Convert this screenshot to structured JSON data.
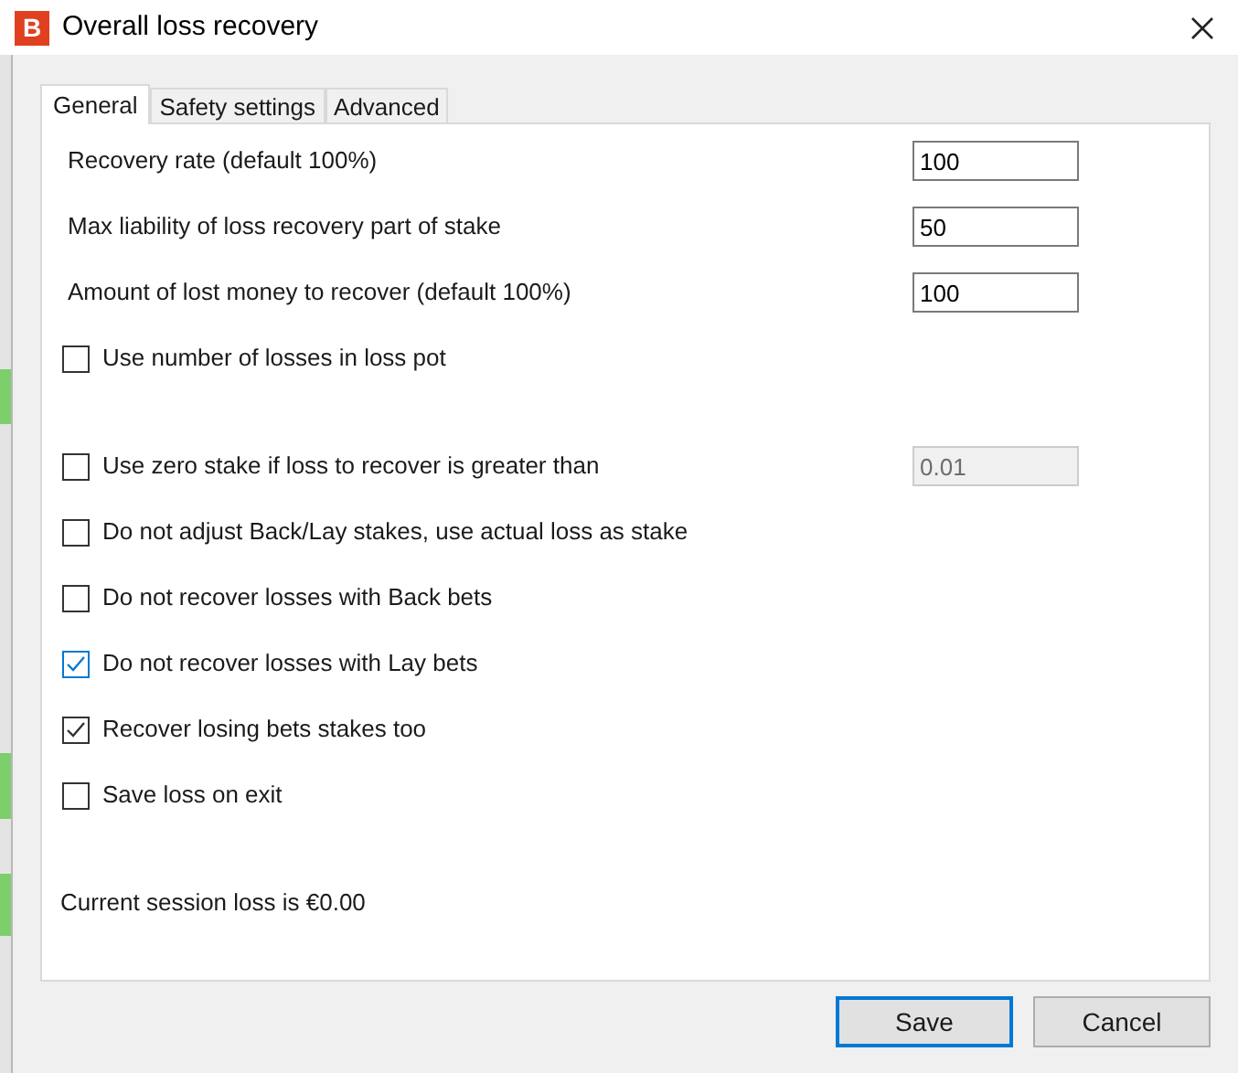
{
  "window": {
    "title": "Overall loss recovery",
    "logo_text": "B"
  },
  "tabs": [
    {
      "label": "General",
      "selected": true
    },
    {
      "label": "Safety settings",
      "selected": false
    },
    {
      "label": "Advanced",
      "selected": false
    }
  ],
  "options": [
    {
      "kind": "field",
      "label": "Recovery rate (default 100%)",
      "value": "100",
      "disabled": false
    },
    {
      "kind": "field",
      "label": "Max liability of loss recovery part of stake",
      "value": "50",
      "disabled": false
    },
    {
      "kind": "field",
      "label": "Amount of lost money to recover (default 100%)",
      "value": "100",
      "disabled": false
    },
    {
      "kind": "checkbox",
      "label": "Use number of losses in loss pot",
      "checked": false,
      "color": "#333333"
    },
    {
      "kind": "checkbox_with_field",
      "label": "Use zero stake if loss to recover is greater than",
      "checked": false,
      "color": "#333333",
      "value": "0.01",
      "disabled": true
    },
    {
      "kind": "checkbox",
      "label": "Do not adjust Back/Lay stakes, use actual loss as stake",
      "checked": false,
      "color": "#333333"
    },
    {
      "kind": "checkbox",
      "label": "Do not recover losses with Back bets",
      "checked": false,
      "color": "#333333"
    },
    {
      "kind": "checkbox",
      "label": "Do not recover losses with Lay bets",
      "checked": true,
      "color": "#0078d7"
    },
    {
      "kind": "checkbox",
      "label": "Recover losing bets stakes too",
      "checked": true,
      "color": "#333333"
    },
    {
      "kind": "checkbox",
      "label": "Save loss on exit",
      "checked": false,
      "color": "#333333"
    }
  ],
  "session_loss": "Current session loss is €0.00",
  "buttons": [
    {
      "label": "Save",
      "default": true
    },
    {
      "label": "Cancel",
      "default": false
    }
  ]
}
